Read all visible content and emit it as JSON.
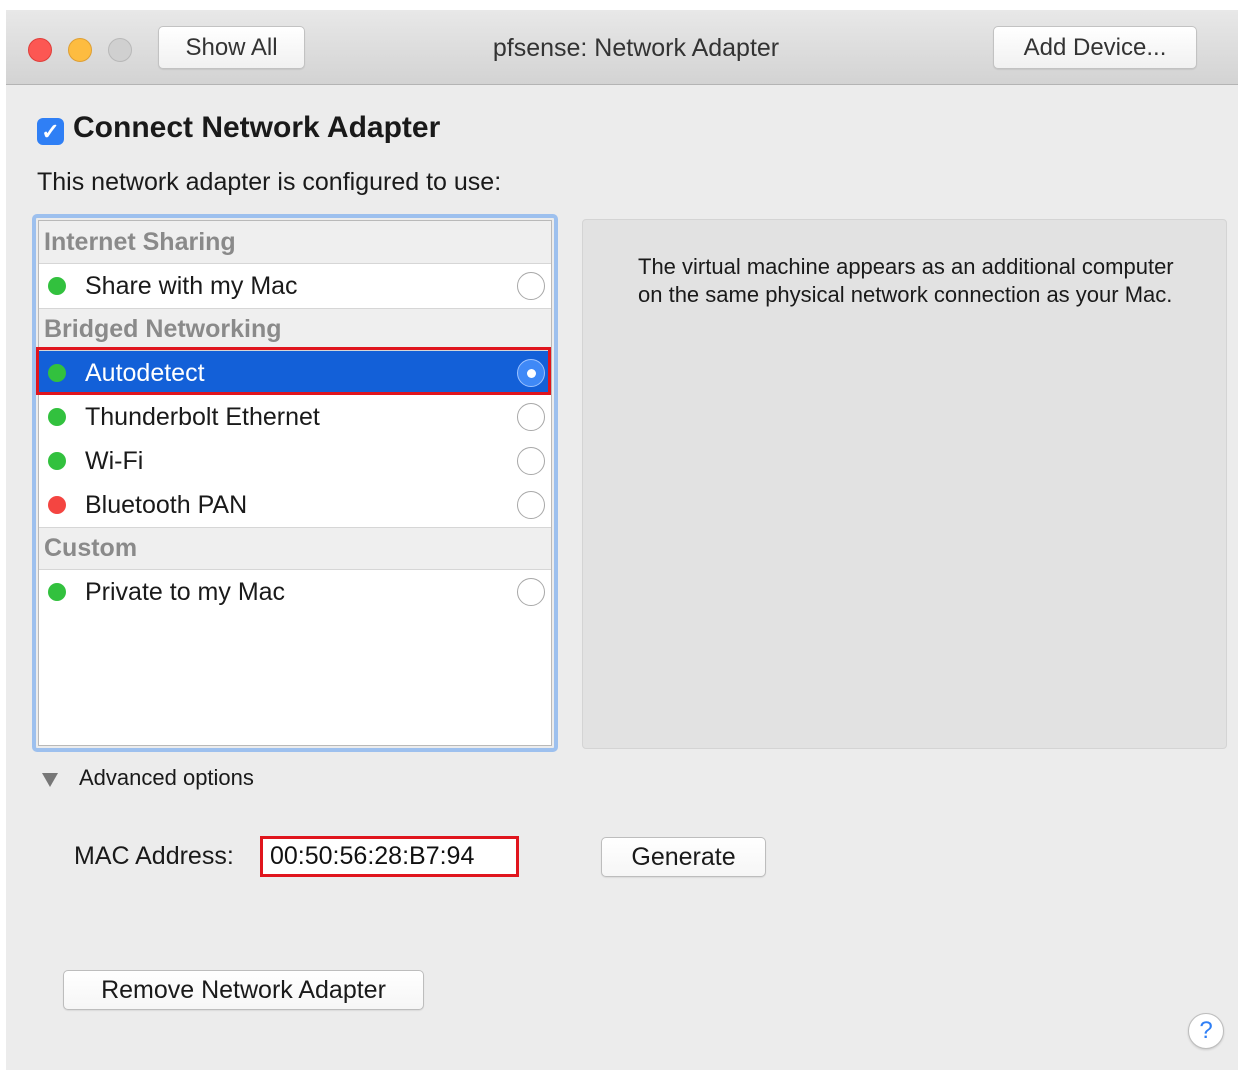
{
  "window": {
    "title": "pfsense: Network Adapter",
    "show_all_label": "Show All",
    "add_device_label": "Add Device..."
  },
  "connect": {
    "label": "Connect Network Adapter",
    "checked": true,
    "check_glyph": "✓"
  },
  "configured_text": "This network adapter is configured to use:",
  "groups": [
    {
      "label": "Internet Sharing",
      "items": [
        {
          "label": "Share with my Mac",
          "status": "green",
          "selected": false
        }
      ]
    },
    {
      "label": "Bridged Networking",
      "items": [
        {
          "label": "Autodetect",
          "status": "green",
          "selected": true
        },
        {
          "label": "Thunderbolt Ethernet",
          "status": "green",
          "selected": false
        },
        {
          "label": "Wi-Fi",
          "status": "green",
          "selected": false
        },
        {
          "label": "Bluetooth PAN",
          "status": "red",
          "selected": false
        }
      ]
    },
    {
      "label": "Custom",
      "items": [
        {
          "label": "Private to my Mac",
          "status": "green",
          "selected": false
        }
      ]
    }
  ],
  "description": "The virtual machine appears as an additional computer on the same physical network connection as your Mac.",
  "advanced": {
    "label": "Advanced options",
    "expanded": true,
    "mac_label": "MAC Address:",
    "mac_value": "00:50:56:28:B7:94",
    "generate_label": "Generate"
  },
  "remove_label": "Remove Network Adapter",
  "help_glyph": "?",
  "colors": {
    "status_green": "#32c13e",
    "status_red": "#f44541",
    "selection": "#1360d8",
    "highlight_box": "#e0151d",
    "checkbox": "#2f7ff5"
  }
}
